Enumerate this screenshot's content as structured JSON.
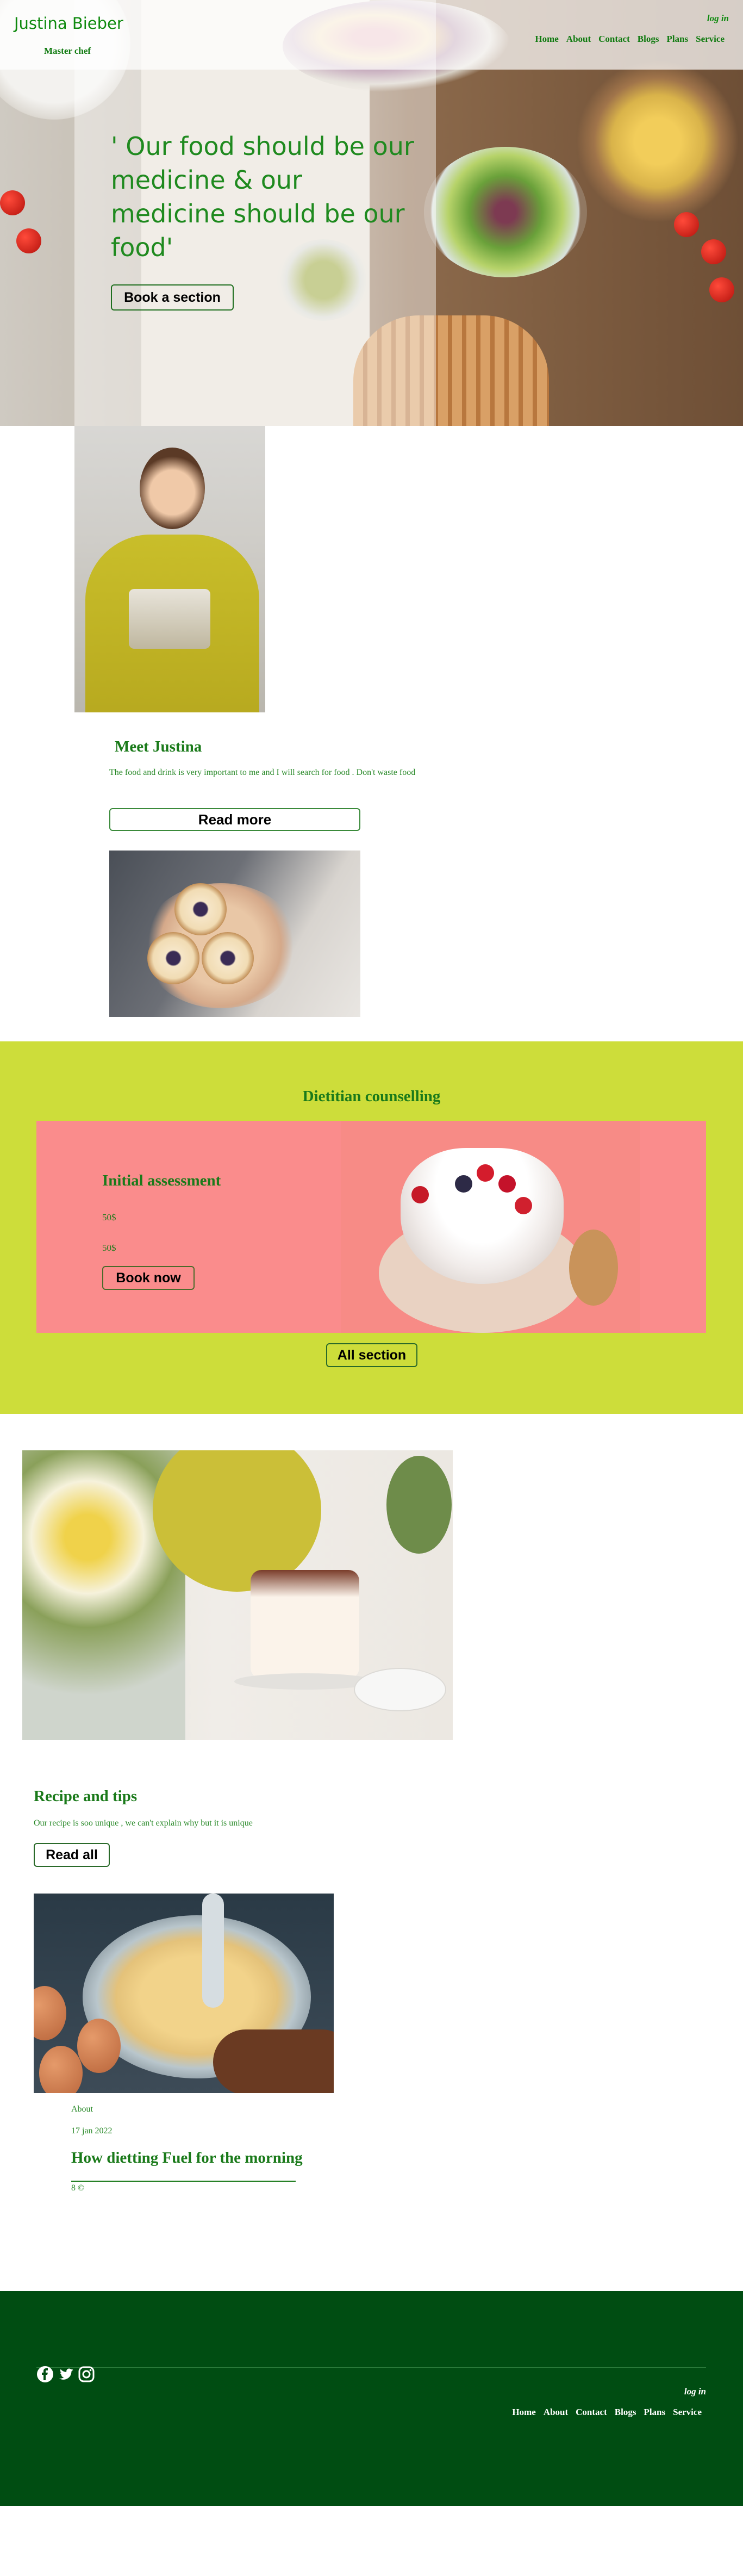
{
  "header": {
    "brand": "Justina Bieber",
    "subtitle": "Master chef",
    "login": "log in",
    "nav": [
      "Home",
      "About",
      "Contact",
      "Blogs",
      "Plans",
      "Service"
    ]
  },
  "hero": {
    "quote": "' Our food should be our medicine & our medicine should be our food'",
    "cta": "Book a section"
  },
  "about": {
    "title": "Meet Justina",
    "text": "The food and drink is very important to me and I will search for food . Don't waste food",
    "cta": "Read more"
  },
  "dietitian": {
    "title": "Dietitian counselling",
    "card_title": "Initial assessment",
    "price1": "50$",
    "price2": "50$",
    "cta": "Book now",
    "all_cta": "All section"
  },
  "recipes": {
    "title": "Recipe and tips",
    "text": "Our recipe is soo unique , we can't explain why but it is unique",
    "cta": "Read all",
    "post": {
      "tag": "About",
      "date": "17 jan 2022",
      "title": "How dietting Fuel for the morning",
      "meta": "8 ©"
    }
  },
  "footer": {
    "login": "log in",
    "nav": [
      "Home",
      "About",
      "Contact",
      "Blogs",
      "Plans",
      "Service"
    ],
    "social": [
      "facebook-icon",
      "twitter-icon",
      "instagram-icon"
    ]
  },
  "colors": {
    "brand_green": "#1a7a1a",
    "dietitian_bg": "#cddd3a",
    "card_bg": "#fa8c8c",
    "footer_bg": "#004d12"
  }
}
